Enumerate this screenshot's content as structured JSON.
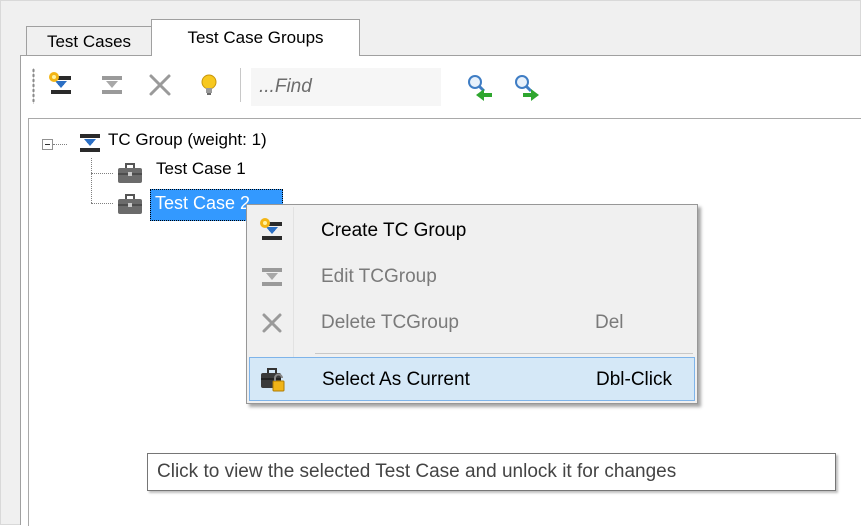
{
  "tabs": [
    {
      "label": "Test Cases",
      "active": false
    },
    {
      "label": "Test Case Groups",
      "active": true
    }
  ],
  "toolbar": {
    "buttons": [
      {
        "icon": "create-group-icon",
        "enabled": true
      },
      {
        "icon": "edit-group-icon",
        "enabled": false
      },
      {
        "icon": "delete-icon",
        "enabled": false
      },
      {
        "icon": "lightbulb-icon",
        "enabled": true
      },
      {
        "icon": "find-previous-icon",
        "enabled": true
      },
      {
        "icon": "find-next-icon",
        "enabled": true
      }
    ],
    "find_placeholder": "...Find"
  },
  "tree": {
    "group": {
      "label": "TC Group (weight: 1)",
      "expanded": true
    },
    "items": [
      {
        "label": "Test Case 1",
        "selected": false
      },
      {
        "label": "Test Case 2",
        "selected": true
      }
    ]
  },
  "context_menu": {
    "items": [
      {
        "label": "Create TC Group",
        "shortcut": "",
        "enabled": true,
        "icon": "create-group-icon"
      },
      {
        "label": "Edit TCGroup",
        "shortcut": "",
        "enabled": false,
        "icon": "edit-group-icon"
      },
      {
        "label": "Delete TCGroup",
        "shortcut": "Del",
        "enabled": false,
        "icon": "delete-icon"
      },
      {
        "label": "Select As Current",
        "shortcut": "Dbl-Click",
        "enabled": true,
        "highlighted": true,
        "icon": "select-current-icon"
      }
    ]
  },
  "tooltip": {
    "text": "Click to view the selected Test Case and unlock it for changes"
  },
  "colors": {
    "selection": "#3399ff",
    "menu_highlight": "#d5e8f7",
    "disabled_text": "#7a7a7a"
  }
}
